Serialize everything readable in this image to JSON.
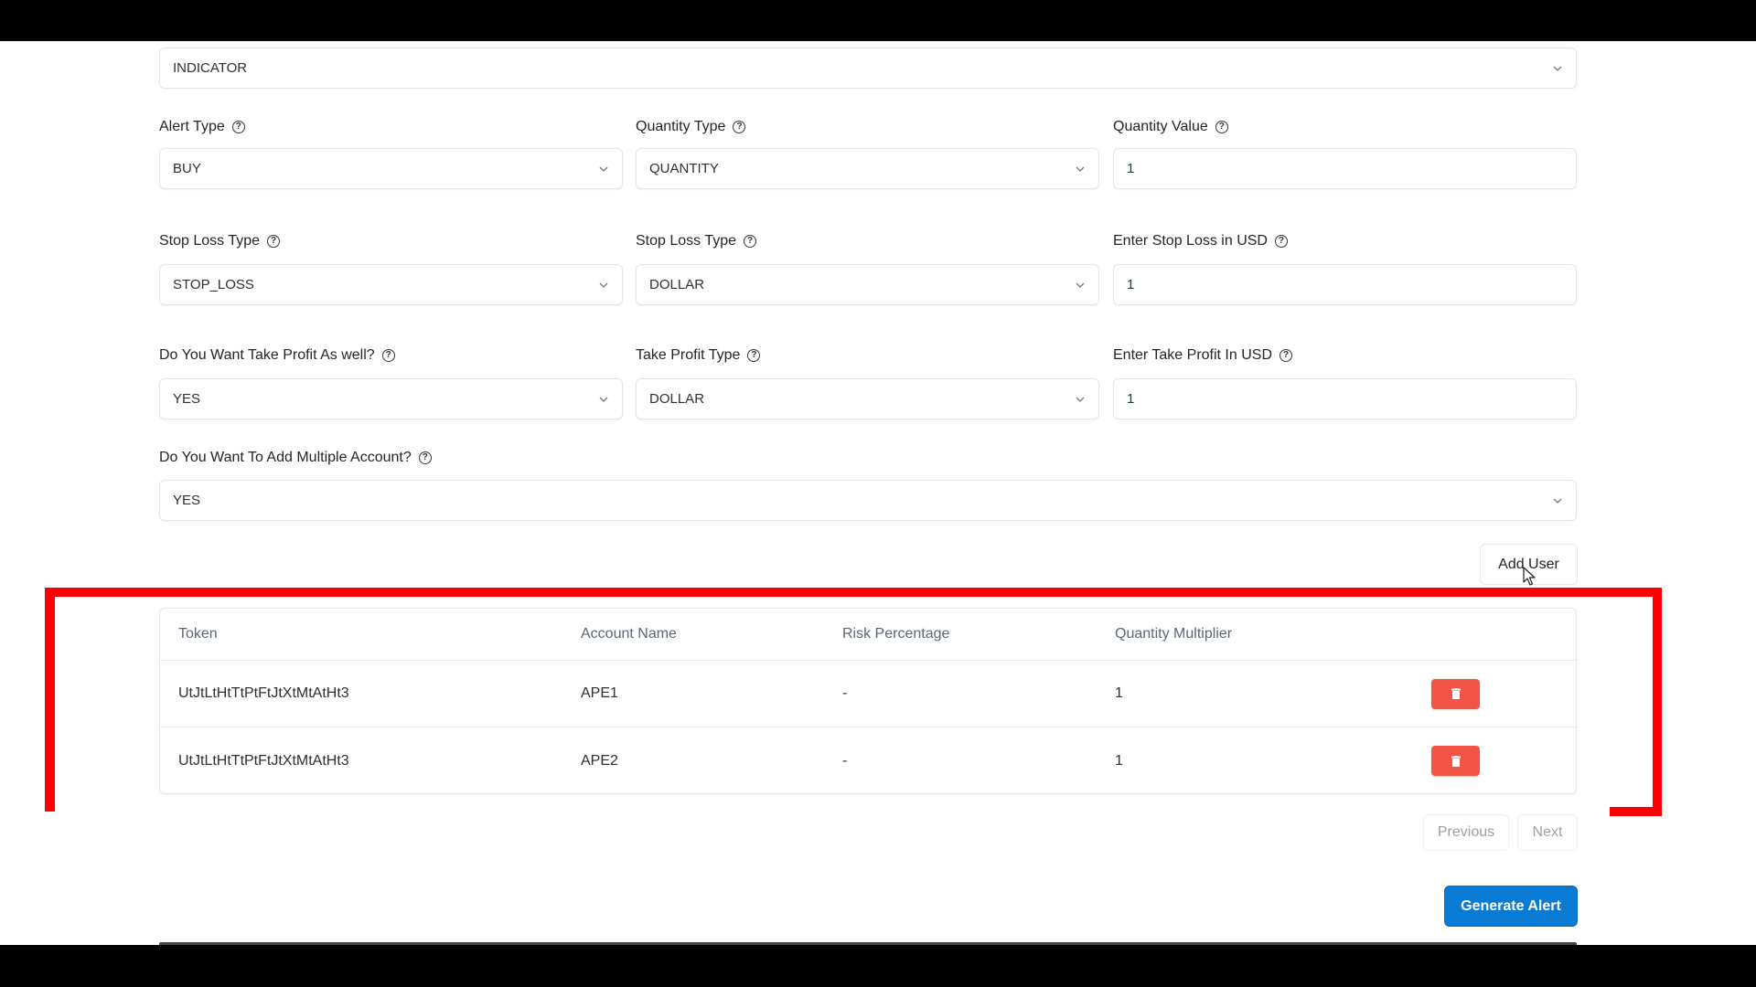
{
  "form": {
    "strategy_select": {
      "value": "INDICATOR"
    },
    "rows": [
      [
        {
          "label": "Alert Type",
          "value": "BUY",
          "kind": "select"
        },
        {
          "label": "Quantity Type",
          "value": "QUANTITY",
          "kind": "select"
        },
        {
          "label": "Quantity Value",
          "value": "1",
          "kind": "input"
        }
      ],
      [
        {
          "label": "Stop Loss Type",
          "value": "STOP_LOSS",
          "kind": "select"
        },
        {
          "label": "Stop Loss Type",
          "value": "DOLLAR",
          "kind": "select"
        },
        {
          "label": "Enter Stop Loss in USD",
          "value": "1",
          "kind": "input"
        }
      ],
      [
        {
          "label": "Do You Want Take Profit As well?",
          "value": "YES",
          "kind": "select"
        },
        {
          "label": "Take Profit Type",
          "value": "DOLLAR",
          "kind": "select"
        },
        {
          "label": "Enter Take Profit In USD",
          "value": "1",
          "kind": "input"
        }
      ]
    ],
    "multiple_account": {
      "label": "Do You Want To Add Multiple Account?",
      "value": "YES"
    },
    "help_icon_glyph": "?"
  },
  "add_user_button": {
    "label": "Add User"
  },
  "accounts_table": {
    "columns": [
      "Token",
      "Account Name",
      "Risk Percentage",
      "Quantity Multiplier",
      ""
    ],
    "rows": [
      {
        "token": "UtJtLtHtTtPtFtJtXtMtAtHt3",
        "account_name": "APE1",
        "risk_percentage": "-",
        "quantity_multiplier": "1",
        "action_icon": "trash-icon"
      },
      {
        "token": "UtJtLtHtTtPtFtJtXtMtAtHt3",
        "account_name": "APE2",
        "risk_percentage": "-",
        "quantity_multiplier": "1",
        "action_icon": "trash-icon"
      }
    ]
  },
  "pagination": {
    "previous_label": "Previous",
    "next_label": "Next"
  },
  "generate_button": {
    "label": "Generate Alert"
  },
  "colors": {
    "primary": "#0a7bd4",
    "danger": "#f25545",
    "annotation": "#ff0000"
  }
}
